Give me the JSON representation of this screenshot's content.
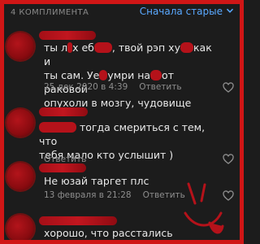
{
  "header": {
    "title": "4 КОМПЛИМЕНТА",
    "sort_label": "Сначала старые"
  },
  "comments": [
    {
      "text": {
        "l1a": "ты л",
        "l1b": "х еб",
        "l1c": ", твой рэп ху",
        "l1d": "как и",
        "l2a": "ты сам. Уе",
        "l2b": "умри на",
        "l2c": "от раковой",
        "l3": "опухоли в мозгу, чудовище"
      },
      "date": "25 дек 2020 в 4:39",
      "reply": "Ответить"
    },
    {
      "text": {
        "l1": "тогда смериться с тем, что",
        "l2": "тебя мало кто услышит )"
      },
      "reply": "Ответить"
    },
    {
      "text": "Не юзай таргет плс",
      "date": "13 февраля в 21:28",
      "reply": "Ответить"
    },
    {
      "text": "хорошо, что расстались"
    }
  ],
  "colors": {
    "accent": "#5aa9ff",
    "redaction": "#b5121a",
    "frame": "#d01616"
  },
  "icons": {
    "sort": "chevron-down-icon",
    "like": "heart-outline-icon"
  }
}
